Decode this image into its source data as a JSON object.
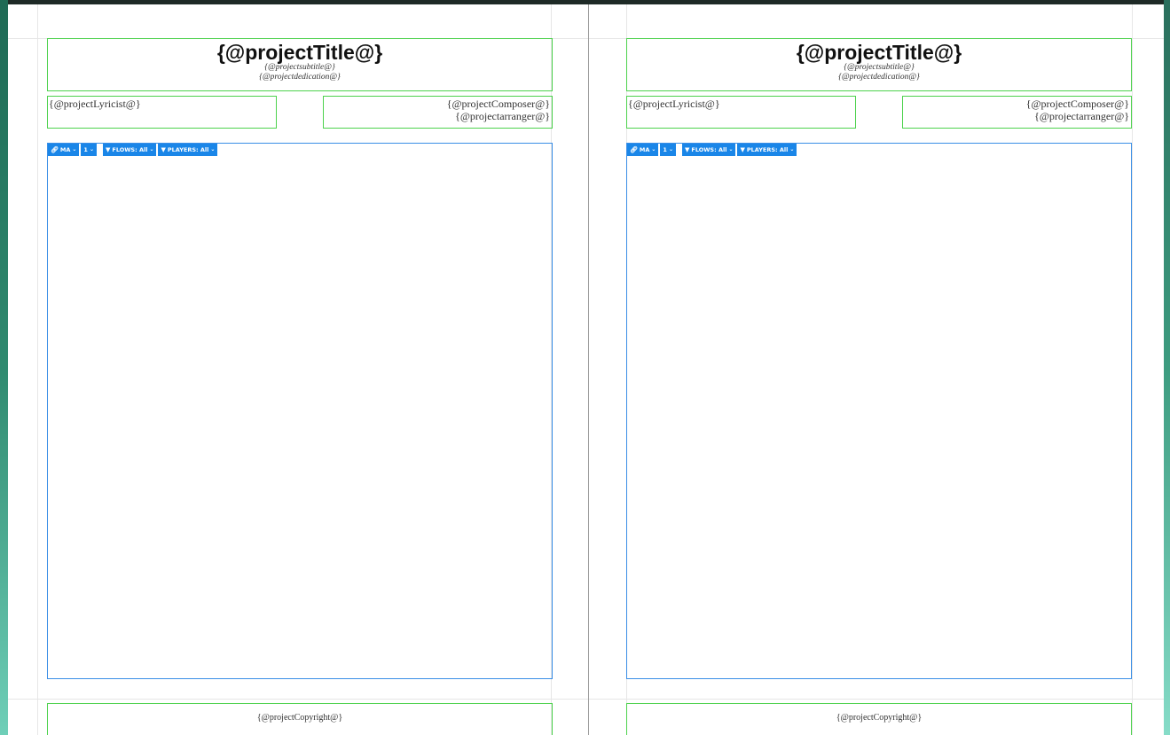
{
  "pages": [
    {
      "title": "{@projectTitle@}",
      "subtitle": "{@projectsubtitle@}",
      "dedication": "{@projectdedication@}",
      "lyricist": "{@projectLyricist@}",
      "composer": "{@projectComposer@}",
      "arranger": "{@projectarranger@}",
      "copyright": "{@projectCopyright@}",
      "toolbar": {
        "ma_label": "MA",
        "num_label": "1",
        "flows_label": "FLOWS: All",
        "players_label": "PLAYERS: All"
      }
    },
    {
      "title": "{@projectTitle@}",
      "subtitle": "{@projectsubtitle@}",
      "dedication": "{@projectdedication@}",
      "lyricist": "{@projectLyricist@}",
      "composer": "{@projectComposer@}",
      "arranger": "{@projectarranger@}",
      "copyright": "{@projectCopyright@}",
      "toolbar": {
        "ma_label": "MA",
        "num_label": "1",
        "flows_label": "FLOWS: All",
        "players_label": "PLAYERS: All"
      }
    }
  ],
  "icons": {
    "link": "link-icon",
    "filter": "filter-icon",
    "chevron": "chevron-down-icon"
  },
  "colors": {
    "text_frame_border": "#4dd24d",
    "music_frame_border": "#3a8ee6",
    "toolbar_bg": "#1a86e8",
    "window_edge": "#2f8a6f"
  }
}
